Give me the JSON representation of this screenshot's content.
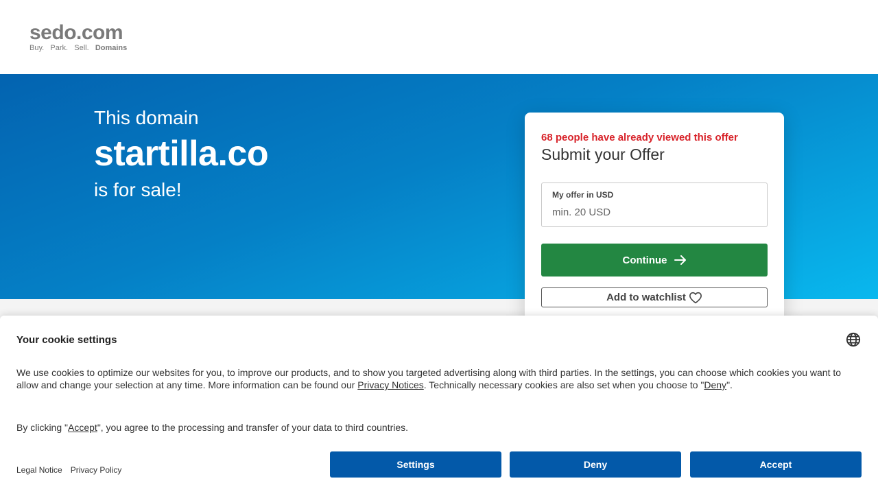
{
  "header": {
    "logo_main": "sedo.com",
    "logo_tag_parts": [
      "Buy.",
      "Park.",
      "Sell."
    ],
    "logo_tag_bold": "Domains"
  },
  "hero": {
    "pre": "This domain",
    "domain": "startilla.co",
    "post": "is for sale!"
  },
  "offer_card": {
    "views_notice": "68 people have already viewed this offer",
    "title": "Submit your Offer",
    "offer_label": "My offer in USD",
    "offer_placeholder": "min. 20 USD",
    "continue_label": "Continue",
    "watchlist_label": "Add to watchlist"
  },
  "cookie_banner": {
    "title": "Your cookie settings",
    "text_part1": "We use cookies to optimize our websites for you, to improve our products, and to show you targeted advertising along with third parties. In the settings, you can choose which cookies you want to allow and change your selection at any time. More information can be found our ",
    "privacy_notices_link": "Privacy Notices",
    "text_part2": ". Technically necessary cookies are also set when you choose to \"",
    "deny_link": "Deny",
    "text_part3": "\".",
    "accept_text_part1": "By clicking \"",
    "accept_link": "Accept",
    "accept_text_part2": "\", you agree to the processing and transfer of your data to third countries.",
    "legal_notice": "Legal Notice",
    "privacy_policy": "Privacy Policy",
    "settings_button": "Settings",
    "deny_button": "Deny",
    "accept_button": "Accept"
  },
  "colors": {
    "brand_blue": "#0359a9",
    "continue_green": "#238742",
    "notice_red": "#d8232a"
  }
}
